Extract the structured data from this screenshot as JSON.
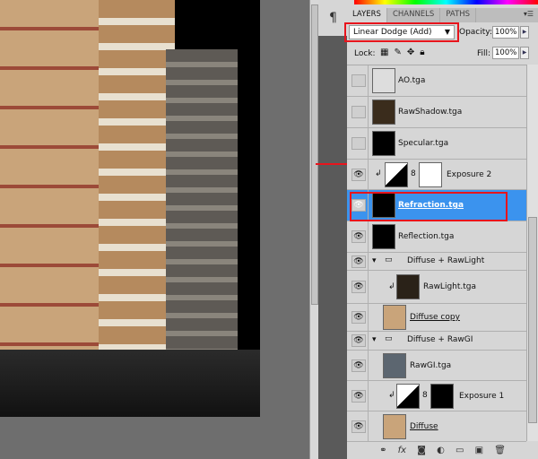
{
  "tabs": [
    "LAYERS",
    "CHANNELS",
    "PATHS"
  ],
  "blend_mode": "Linear Dodge (Add)",
  "opacity_label": "Opacity:",
  "opacity": "100%",
  "lock_label": "Lock:",
  "fill_label": "Fill:",
  "fill": "100%",
  "layers": [
    {
      "name": "AO.tga",
      "visible": false
    },
    {
      "name": "RawShadow.tga",
      "visible": false
    },
    {
      "name": "Specular.tga",
      "visible": false
    },
    {
      "name": "Exposure 2",
      "visible": true,
      "type": "adjustment"
    },
    {
      "name": "Refraction.tga",
      "visible": true,
      "selected": true
    },
    {
      "name": "Reflection.tga",
      "visible": true
    },
    {
      "name": "Diffuse + RawLight",
      "visible": true,
      "type": "group"
    },
    {
      "name": "RawLight.tga",
      "visible": true
    },
    {
      "name": "Diffuse copy",
      "visible": true
    },
    {
      "name": "Diffuse + RawGI",
      "visible": true,
      "type": "group"
    },
    {
      "name": "RawGI.tga",
      "visible": true
    },
    {
      "name": "Exposure 1",
      "visible": true,
      "type": "adjustment"
    },
    {
      "name": "Diffuse",
      "visible": true
    }
  ],
  "colors": {
    "selection": "#3b93ee",
    "highlight": "#e8141c"
  }
}
